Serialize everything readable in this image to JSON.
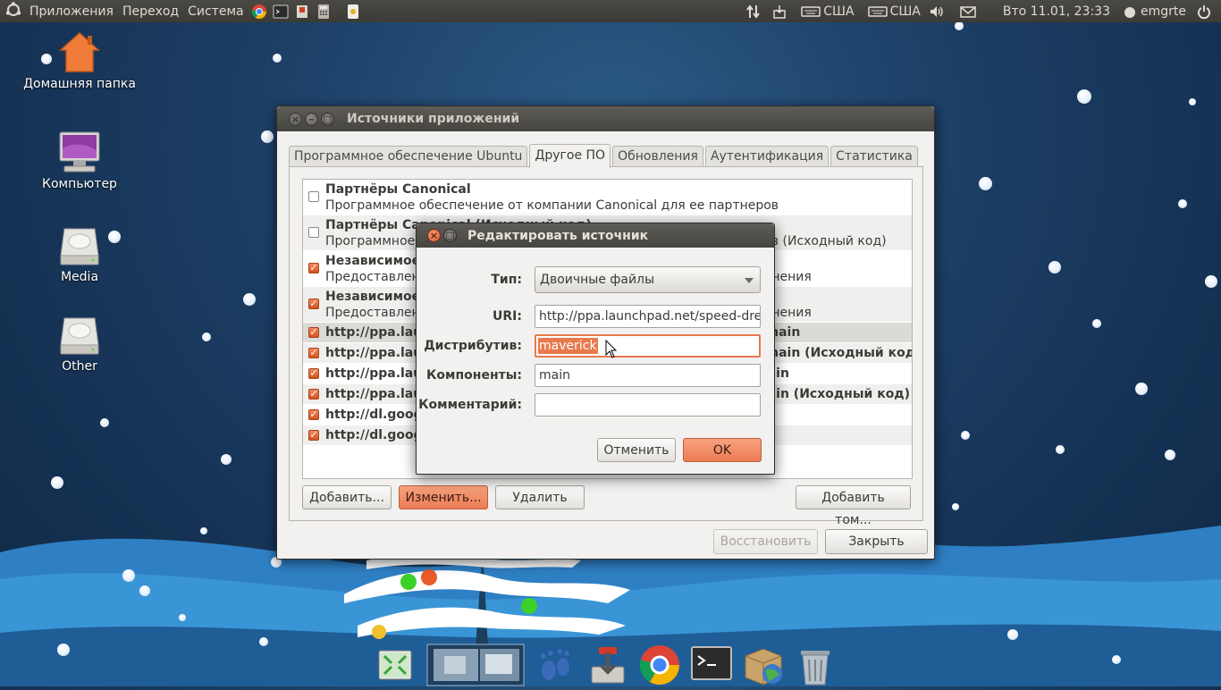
{
  "top_panel": {
    "menus": [
      "Приложения",
      "Переход",
      "Система"
    ],
    "keyboard_1": "США",
    "keyboard_2": "США",
    "datetime": "Вто 11.01, 23:33",
    "user": "emgrte"
  },
  "desktop_icons": [
    {
      "label": "Домашняя папка",
      "icon": "home-folder-icon"
    },
    {
      "label": "Компьютер",
      "icon": "computer-icon"
    },
    {
      "label": "Media",
      "icon": "drive-icon"
    },
    {
      "label": "Other",
      "icon": "drive-icon"
    }
  ],
  "main_window": {
    "title": "Источники приложений",
    "tabs": [
      {
        "label": "Программное обеспечение Ubuntu",
        "active": false
      },
      {
        "label": "Другое ПО",
        "active": true
      },
      {
        "label": "Обновления",
        "active": false
      },
      {
        "label": "Аутентификация",
        "active": false
      },
      {
        "label": "Статистика",
        "active": false
      }
    ],
    "sources": [
      {
        "title": "Партнёры Canonical",
        "desc": "Программное обеспечение от компании Canonical для ее партнеров",
        "checked": false
      },
      {
        "title": "Партнёры Canonical (Исходный код)",
        "desc": "Программное обеспечение от компании Canonical для ее партнеров (Исходный код)",
        "checked": false
      },
      {
        "title": "Независимое ПО",
        "desc": "Предоставлено сторонними разработчиками программного обеспечения",
        "checked": true
      },
      {
        "title": "Независимое ПО (Исходный код)",
        "desc": "Предоставлено сторонними разработчиками программного обеспечения",
        "checked": true
      },
      {
        "title": "http://ppa.launchpad.net/speed-dreams/ppa/ubuntu maverick main",
        "checked": true
      },
      {
        "title": "http://ppa.launchpad.net/speed-dreams/ppa/ubuntu maverick main (Исходный код)",
        "checked": true
      },
      {
        "title": "http://ppa.launchpad.net/ubuntu-wine/ppa/ubuntu maverick main",
        "checked": true
      },
      {
        "title": "http://ppa.launchpad.net/ubuntu-wine/ppa/ubuntu maverick main (Исходный код)",
        "checked": true
      },
      {
        "title": "http://dl.google.com/linux/chrome/deb/ stable main",
        "checked": true
      },
      {
        "title": "http://dl.google.com/linux/talkplugin/deb/ stable main",
        "checked": true
      }
    ],
    "buttons": {
      "add": "Добавить...",
      "edit": "Изменить...",
      "remove": "Удалить",
      "add_volume": "Добавить том...",
      "restore": "Восстановить",
      "close": "Закрыть"
    }
  },
  "edit_dialog": {
    "title": "Редактировать источник",
    "labels": {
      "type": "Тип:",
      "uri": "URI:",
      "distribution": "Дистрибутив:",
      "components": "Компоненты:",
      "comment": "Комментарий:"
    },
    "values": {
      "type": "Двоичные файлы",
      "uri": "http://ppa.launchpad.net/speed-dreams/ppa/ubuntu",
      "distribution": "maverick",
      "components": "main",
      "comment": ""
    },
    "buttons": {
      "cancel": "Отменить",
      "ok": "OK"
    }
  },
  "colors": {
    "accent": "#ec7c55",
    "panel": "#3c3b37",
    "window_bg": "#f2f1f0"
  }
}
